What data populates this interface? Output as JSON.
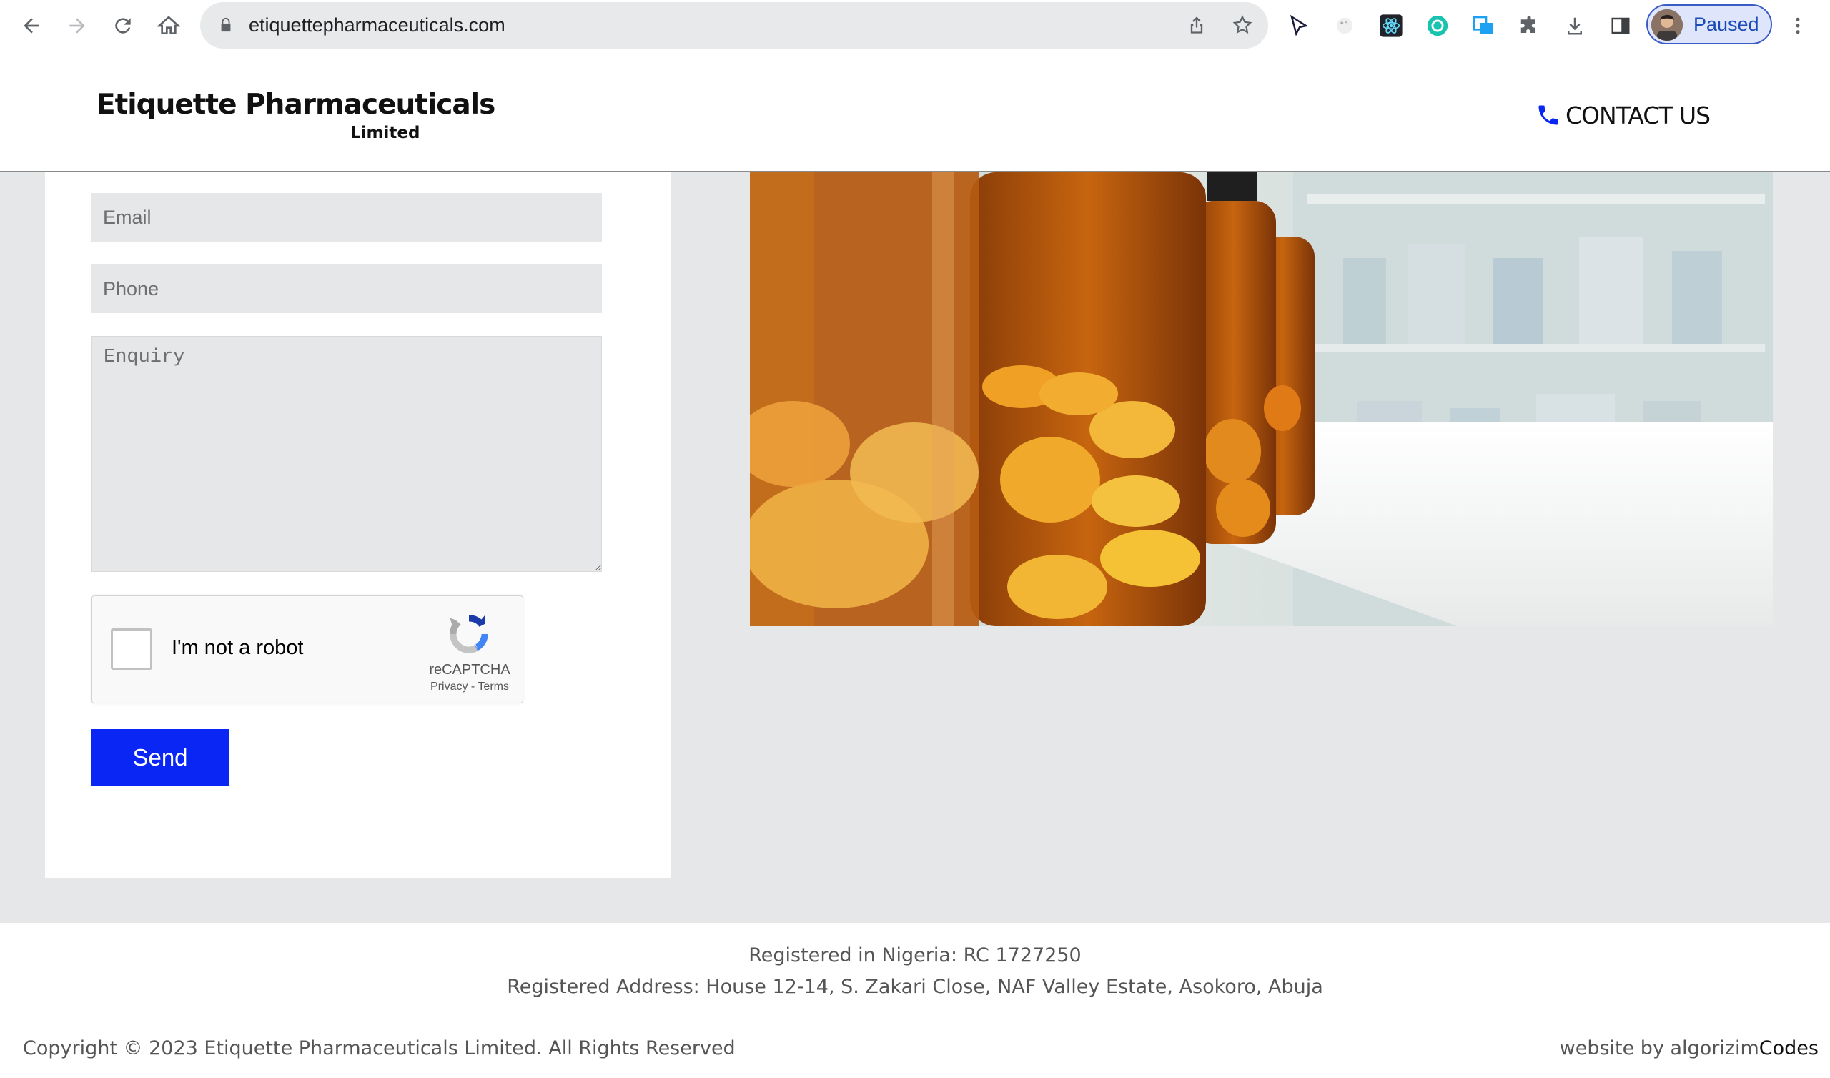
{
  "browser": {
    "url": "etiquettepharmaceuticals.com",
    "profile_label": "Paused",
    "accent_color": "#3b5bc4"
  },
  "header": {
    "logo_main": "Etiquette Pharmaceuticals",
    "logo_sub": "Limited",
    "contact_label": "CONTACT US",
    "contact_icon": "phone-icon"
  },
  "form": {
    "email_placeholder": "Email",
    "phone_placeholder": "Phone",
    "enquiry_placeholder": "Enquiry",
    "recaptcha": {
      "label": "I'm not a robot",
      "brand": "reCAPTCHA",
      "links": "Privacy - Terms"
    },
    "send_label": "Send",
    "send_color": "#0a26f5"
  },
  "footer": {
    "registration": "Registered in Nigeria: RC 1727250",
    "address": "Registered Address: House 12-14, S. Zakari Close, NAF Valley Estate, Asokoro, Abuja",
    "copyright": "Copyright © 2023 Etiquette Pharmaceuticals Limited. All Rights Reserved",
    "credit_prefix": "website by algorizim",
    "credit_brand": "Codes"
  }
}
